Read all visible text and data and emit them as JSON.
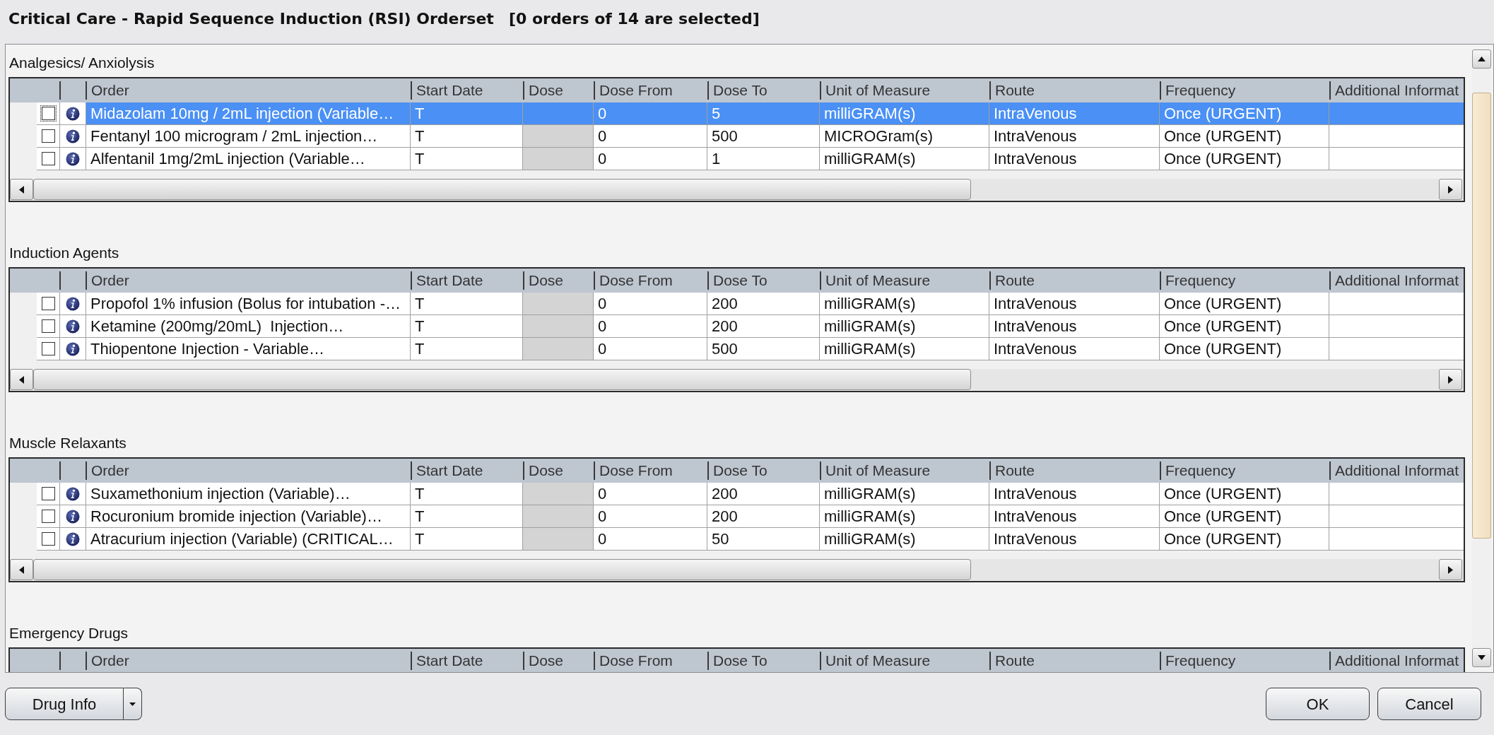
{
  "window": {
    "title": "Critical Care - Rapid Sequence Induction (RSI) Orderset",
    "selection_status": "[0 orders of 14 are selected]"
  },
  "sections": [
    {
      "title": "Analgesics/ Anxiolysis",
      "columns": [
        "Order",
        "Start Date",
        "Dose",
        "Dose From",
        "Dose To",
        "Unit of Measure",
        "Route",
        "Frequency",
        "Additional Informat"
      ],
      "rows": [
        {
          "checked": false,
          "selected": true,
          "order": "Midazolam 10mg / 2mL injection (Variable…",
          "start_date": "T",
          "dose_disabled": true,
          "dose_from": "0",
          "dose_to": "5",
          "unit_of_measure": "milliGRAM(s)",
          "route": "IntraVenous",
          "frequency": "Once (URGENT)"
        },
        {
          "checked": false,
          "selected": false,
          "order": "Fentanyl 100 microgram / 2mL injection…",
          "start_date": "T",
          "dose_disabled": true,
          "dose_from": "0",
          "dose_to": "500",
          "unit_of_measure": "MICROGram(s)",
          "route": "IntraVenous",
          "frequency": "Once (URGENT)"
        },
        {
          "checked": false,
          "selected": false,
          "order": "Alfentanil 1mg/2mL injection (Variable…",
          "start_date": "T",
          "dose_disabled": true,
          "dose_from": "0",
          "dose_to": "1",
          "unit_of_measure": "milliGRAM(s)",
          "route": "IntraVenous",
          "frequency": "Once (URGENT)"
        }
      ]
    },
    {
      "title": "Induction Agents",
      "columns": [
        "Order",
        "Start Date",
        "Dose",
        "Dose From",
        "Dose To",
        "Unit of Measure",
        "Route",
        "Frequency",
        "Additional Informat"
      ],
      "rows": [
        {
          "checked": false,
          "selected": false,
          "order": "Propofol 1% infusion (Bolus for intubation -…",
          "start_date": "T",
          "dose_disabled": true,
          "dose_from": "0",
          "dose_to": "200",
          "unit_of_measure": "milliGRAM(s)",
          "route": "IntraVenous",
          "frequency": "Once (URGENT)"
        },
        {
          "checked": false,
          "selected": false,
          "order": "Ketamine (200mg/20mL)  Injection…",
          "start_date": "T",
          "dose_disabled": true,
          "dose_from": "0",
          "dose_to": "200",
          "unit_of_measure": "milliGRAM(s)",
          "route": "IntraVenous",
          "frequency": "Once (URGENT)"
        },
        {
          "checked": false,
          "selected": false,
          "order": "Thiopentone Injection - Variable…",
          "start_date": "T",
          "dose_disabled": true,
          "dose_from": "0",
          "dose_to": "500",
          "unit_of_measure": "milliGRAM(s)",
          "route": "IntraVenous",
          "frequency": "Once (URGENT)"
        }
      ]
    },
    {
      "title": "Muscle Relaxants",
      "columns": [
        "Order",
        "Start Date",
        "Dose",
        "Dose From",
        "Dose To",
        "Unit of Measure",
        "Route",
        "Frequency",
        "Additional Informat"
      ],
      "rows": [
        {
          "checked": false,
          "selected": false,
          "order": "Suxamethonium injection (Variable)…",
          "start_date": "T",
          "dose_disabled": true,
          "dose_from": "0",
          "dose_to": "200",
          "unit_of_measure": "milliGRAM(s)",
          "route": "IntraVenous",
          "frequency": "Once (URGENT)"
        },
        {
          "checked": false,
          "selected": false,
          "order": "Rocuronium bromide injection (Variable)…",
          "start_date": "T",
          "dose_disabled": true,
          "dose_from": "0",
          "dose_to": "200",
          "unit_of_measure": "milliGRAM(s)",
          "route": "IntraVenous",
          "frequency": "Once (URGENT)"
        },
        {
          "checked": false,
          "selected": false,
          "order": "Atracurium injection (Variable) (CRITICAL…",
          "start_date": "T",
          "dose_disabled": true,
          "dose_from": "0",
          "dose_to": "50",
          "unit_of_measure": "milliGRAM(s)",
          "route": "IntraVenous",
          "frequency": "Once (URGENT)"
        }
      ]
    },
    {
      "title": "Emergency Drugs",
      "columns": [
        "Order",
        "Start Date",
        "Dose",
        "Dose From",
        "Dose To",
        "Unit of Measure",
        "Route",
        "Frequency",
        "Additional Informat"
      ]
    }
  ],
  "footer": {
    "drug_info": "Drug Info",
    "buttons": [
      "OK",
      "Cancel"
    ]
  }
}
